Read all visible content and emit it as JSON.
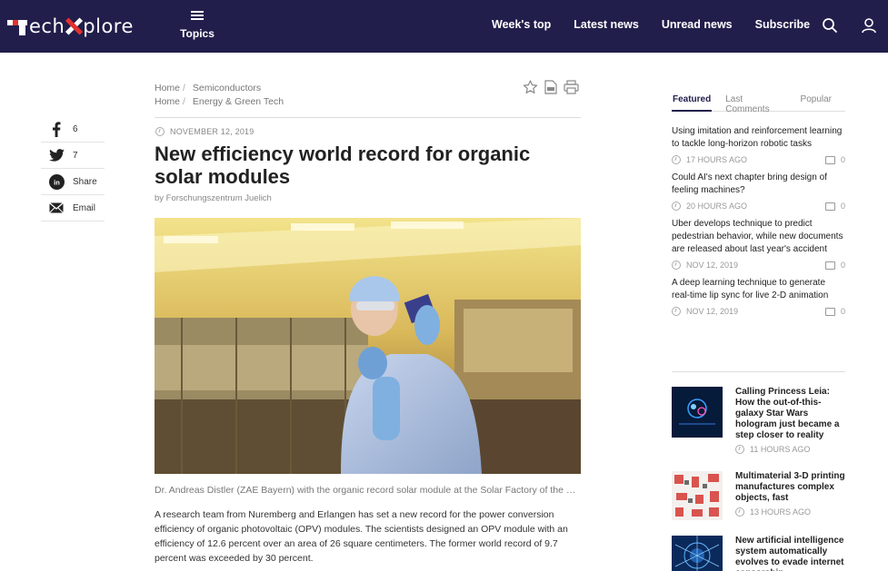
{
  "header": {
    "logo_text_a": "ech",
    "logo_text_b": "plore",
    "topics_label": "Topics",
    "nav": [
      "Week's top",
      "Latest news",
      "Unread news",
      "Subscribe"
    ]
  },
  "colors": {
    "header_bg": "#221e4b",
    "brand_red": "#e3312d"
  },
  "share": {
    "facebook_count": "6",
    "twitter_count": "7",
    "linkedin_label": "Share",
    "email_label": "Email"
  },
  "breadcrumbs": [
    {
      "home": "Home",
      "section": "Semiconductors"
    },
    {
      "home": "Home",
      "section": "Energy & Green Tech"
    }
  ],
  "article": {
    "date": "NOVEMBER 12, 2019",
    "title": "New efficiency world record for organic solar modules",
    "byline": "by Forschungszentrum Juelich",
    "caption": "Dr. Andreas Distler (ZAE Bayern) with the organic record solar module at the Solar Factory of the Future in Nuremberg.",
    "body": "A research team from Nuremberg and Erlangen has set a new record for the power conversion efficiency of organic photovoltaic (OPV) modules. The scientists designed an OPV module with an efficiency of 12.6 percent over an area of 26 square centimeters. The former world record of 9.7 percent was exceeded by 30 percent."
  },
  "sidebar": {
    "tabs": [
      "Featured",
      "Last Comments",
      "Popular"
    ],
    "feed": [
      {
        "title": "Using imitation and reinforcement learning to tackle long-horizon robotic tasks",
        "time": "17 HOURS AGO",
        "comments": "0"
      },
      {
        "title": "Could AI's next chapter bring design of feeling machines?",
        "time": "20 HOURS AGO",
        "comments": "0"
      },
      {
        "title": "Uber develops technique to predict pedestrian behavior, while new documents are released about last year's accident",
        "time": "NOV 12, 2019",
        "comments": "0"
      },
      {
        "title": "A deep learning technique to generate real-time lip sync for live 2-D animation",
        "time": "NOV 12, 2019",
        "comments": "0"
      }
    ],
    "related": [
      {
        "title": "Calling Princess Leia: How the out-of-this-galaxy Star Wars hologram just became a step closer to reality",
        "time": "11 HOURS AGO"
      },
      {
        "title": "Multimaterial 3-D printing manufactures complex objects, fast",
        "time": "13 HOURS AGO"
      },
      {
        "title": "New artificial intelligence system automatically evolves to evade internet censorship",
        "time": ""
      }
    ]
  }
}
